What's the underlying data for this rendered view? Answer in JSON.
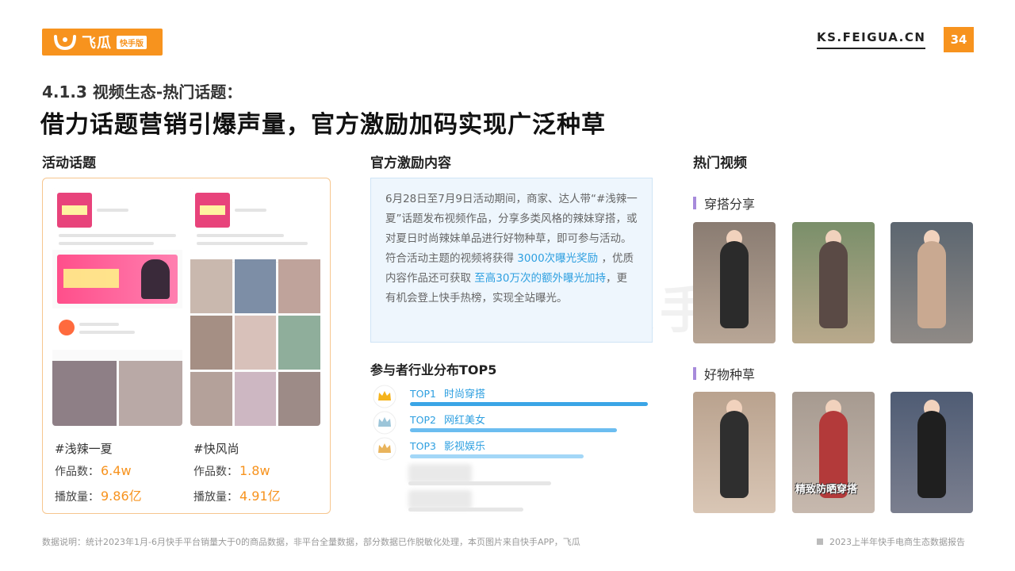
{
  "header": {
    "logo_name": "飞瓜",
    "logo_tag": "快手版",
    "site_url": "KS.FEIGUA.CN",
    "page_number": "34",
    "section_title": "4.1.3 视频生态-热门话题：",
    "main_title": "借力话题营销引爆声量，官方激励加码实现广泛种草"
  },
  "columns": {
    "topics_title": "活动话题",
    "incentives_title": "官方激励内容",
    "hot_videos_title": "热门视频"
  },
  "topics": [
    {
      "tag": "#浅辣一夏",
      "works_label": "作品数：",
      "works_value": "6.4w",
      "plays_label": "播放量：",
      "plays_value": "9.86亿"
    },
    {
      "tag": "#快风尚",
      "works_label": "作品数：",
      "works_value": "1.8w",
      "plays_label": "播放量：",
      "plays_value": "4.91亿"
    }
  ],
  "incentives": {
    "p1": "6月28日至7月9日活动期间，商家、达人带“#浅辣一夏”话题发布视频作品，分享多类风格的辣妹穿搭，或对夏日时尚辣妹单品进行好物种草，即可参与活动。",
    "p2_a": "符合活动主题的视频将获得",
    "p2_hl1": "3000次曝光奖励",
    "p2_b": "，优质内容作品还可获取",
    "p2_hl2": "至高30万次的额外曝光加持",
    "p2_c": "，更有机会登上快手热榜，实现全站曝光。"
  },
  "top5": {
    "title": "参与者行业分布TOP5",
    "items": [
      {
        "rank": "TOP1",
        "name": "时尚穿搭",
        "level": 1.0,
        "bar_color": "#3aa5e6",
        "crown_color": "#f5b31b"
      },
      {
        "rank": "TOP2",
        "name": "网红美女",
        "level": 0.87,
        "bar_color": "#6cbdf0",
        "crown_color": "#9cc5d9"
      },
      {
        "rank": "TOP3",
        "name": "影视娱乐",
        "level": 0.73,
        "bar_color": "#a3d7f7",
        "crown_color": "#e9b45c"
      }
    ]
  },
  "hot_videos": {
    "group1_title": "穿搭分享",
    "group2_title": "好物种草",
    "caption_g2_v2": "精致防晒穿搭"
  },
  "watermark": "快手版",
  "footer": {
    "note": "数据说明：统计2023年1月-6月快手平台销量大于0的商品数据，非平台全量数据，部分数据已作脱敏化处理，本页图片来自快手APP，飞瓜",
    "report_name": "2023上半年快手电商生态数据报告"
  },
  "colors": {
    "brand_orange": "#f7931e",
    "accent_blue": "#2d9fe0",
    "sub_head_bar": "#a78bdb"
  }
}
